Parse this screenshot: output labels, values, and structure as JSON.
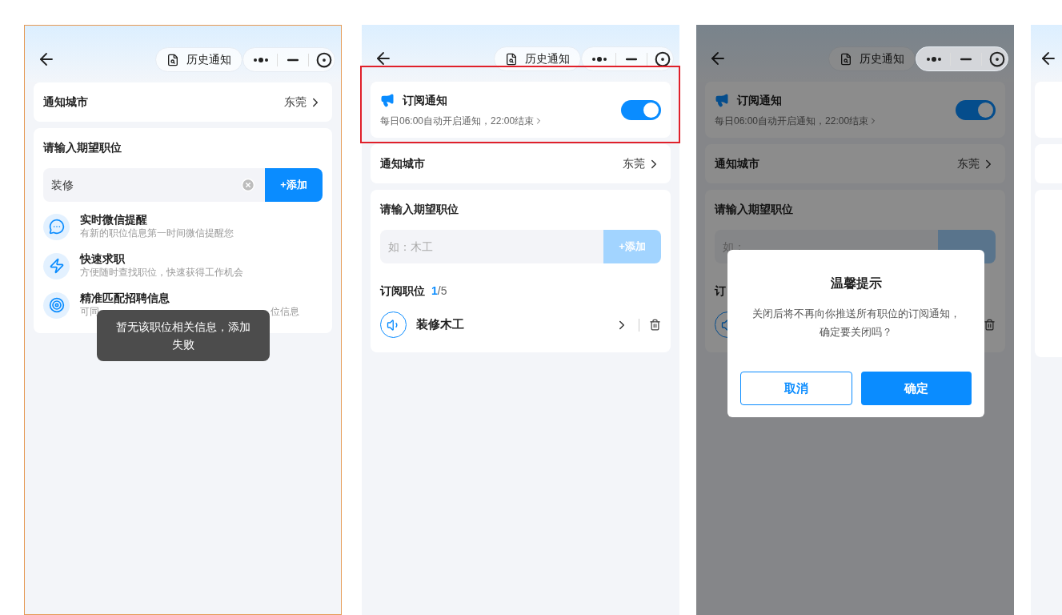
{
  "screens": [
    {
      "kind": "search",
      "selected": true,
      "history_label": "历史通知",
      "city": {
        "label": "通知城市",
        "value": "东莞"
      },
      "position": {
        "title": "请输入期望职位",
        "input": {
          "value": "装修"
        },
        "add_label": "+添加",
        "add_disabled": false
      },
      "features": [
        {
          "title": "实时微信提醒",
          "desc": "有新的职位信息第一时间微信提醒您"
        },
        {
          "title": "快速求职",
          "desc": "方便随时查找职位，快速获得工作机会"
        },
        {
          "title": "精准匹配招聘信息",
          "desc": "可同",
          "desc_end": "位信息"
        }
      ],
      "toast": "暂无该职位相关信息，添加失败"
    },
    {
      "kind": "subscribed",
      "selected": false,
      "highlighted": true,
      "history_label": "历史通知",
      "subscribe": {
        "title": "订阅通知",
        "subtitle": "每日06:00自动开启通知，22:00结束",
        "on": true
      },
      "city": {
        "label": "通知城市",
        "value": "东莞"
      },
      "position": {
        "title": "请输入期望职位",
        "input": {
          "placeholder": "如：木工"
        },
        "add_label": "+添加",
        "add_disabled": true
      },
      "subscribed": {
        "title": "订阅职位",
        "count": "1",
        "total": "/5",
        "items": [
          {
            "kind": "position",
            "name": "装修木工"
          }
        ]
      }
    },
    {
      "kind": "subscribed",
      "selected": false,
      "dimmed": true,
      "history_label": "历史通知",
      "subscribe": {
        "title": "订阅通知",
        "subtitle": "每日06:00自动开启通知，22:00结束",
        "on": true
      },
      "city": {
        "label": "通知城市",
        "value": "东莞"
      },
      "position": {
        "title": "请输入期望职位",
        "input": {
          "placeholder": "如："
        },
        "add_disabled": true
      },
      "subscribed": {
        "title": "订",
        "items": [
          {
            "kind": "position"
          }
        ]
      },
      "dialog": {
        "title": "温馨提示",
        "message": "关闭后将不再向你推送所有职位的订阅通知，确定要关闭吗？",
        "cancel": "取消",
        "confirm": "确定"
      }
    },
    {
      "kind": "clipped",
      "selected": false
    }
  ]
}
